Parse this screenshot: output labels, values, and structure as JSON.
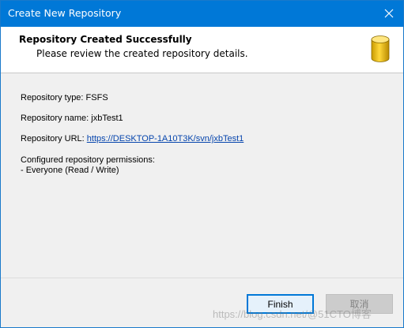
{
  "window": {
    "title": "Create New Repository"
  },
  "header": {
    "title": "Repository Created Successfully",
    "subtitle": "Please review the created repository details."
  },
  "details": {
    "type_line": "Repository type: FSFS",
    "name_line": "Repository name: jxbTest1",
    "url_label": "Repository URL: ",
    "url_value": "https://DESKTOP-1A10T3K/svn/jxbTest1",
    "permissions_heading": "Configured repository permissions:",
    "permissions_item": "- Everyone (Read / Write)"
  },
  "buttons": {
    "finish": "Finish",
    "cancel": "取消"
  },
  "watermark": "https://blog.csdn.net/@51CTO博客",
  "colors": {
    "titlebar": "#0078d7",
    "link": "#0645ad",
    "icon_gold": "#e8b800"
  },
  "icons": {
    "close": "close-icon",
    "repository": "database-icon"
  }
}
